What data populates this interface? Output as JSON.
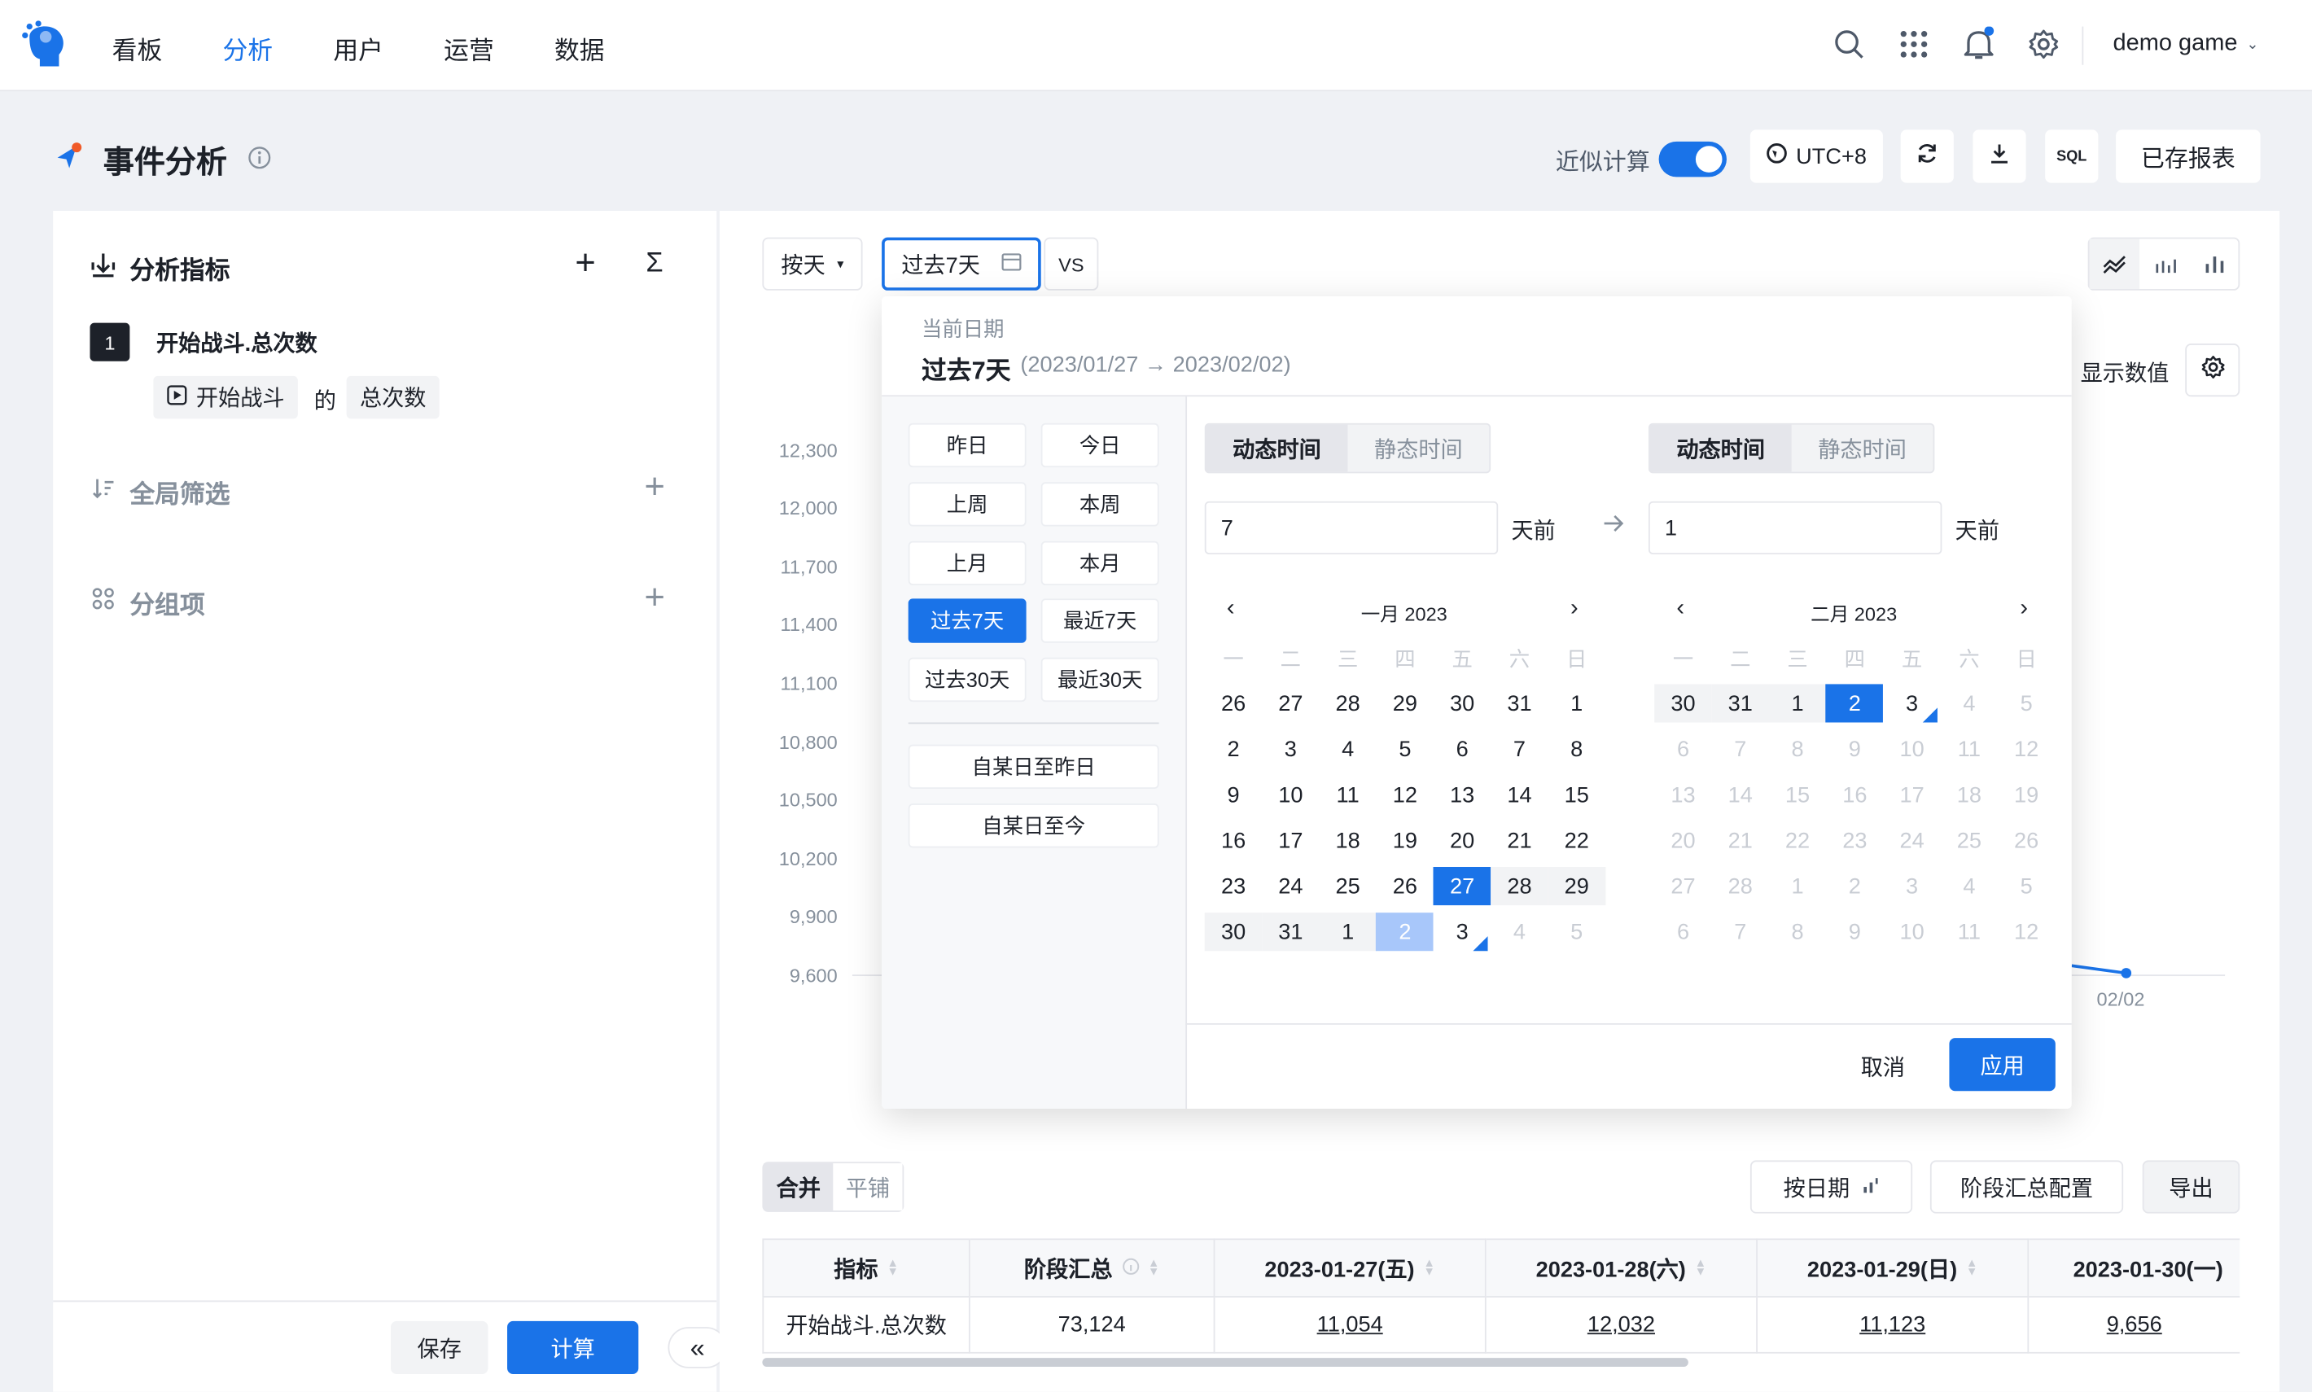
{
  "nav": {
    "items": [
      "看板",
      "分析",
      "用户",
      "运营",
      "数据"
    ],
    "active": "分析",
    "user": "demo game"
  },
  "page": {
    "title": "事件分析"
  },
  "toolbar": {
    "approx_label": "近似计算",
    "approx_on": true,
    "timezone": "UTC+8",
    "sql": "SQL",
    "saved": "已存报表"
  },
  "left": {
    "metrics_title": "分析指标",
    "metric_index": "1",
    "metric_name": "开始战斗.总次数",
    "event_tag": "开始战斗",
    "of": "的",
    "agg_tag": "总次数",
    "filter_title": "全局筛选",
    "group_title": "分组项",
    "save": "保存",
    "calc": "计算",
    "collapse": "«"
  },
  "controls": {
    "granularity": "按天",
    "range": "过去7天",
    "vs": "VS",
    "show_values": "显示数值"
  },
  "chart_data": {
    "type": "line",
    "y_ticks": [
      "12,300",
      "12,000",
      "11,700",
      "11,400",
      "11,100",
      "10,800",
      "10,500",
      "10,200",
      "9,900",
      "9,600"
    ],
    "x_visible": [
      "02/02"
    ]
  },
  "picker": {
    "current_label": "当前日期",
    "current_value": "过去7天",
    "current_range": "(2023/01/27 → 2023/02/02)",
    "quick": [
      [
        "昨日",
        "今日"
      ],
      [
        "上周",
        "本周"
      ],
      [
        "上月",
        "本月"
      ],
      [
        "过去7天",
        "最近7天"
      ],
      [
        "过去30天",
        "最近30天"
      ]
    ],
    "since_yesterday": "自某日至昨日",
    "since_today": "自某日至今",
    "tab_dynamic": "动态时间",
    "tab_static": "静态时间",
    "start_value": "7",
    "end_value": "1",
    "days_ago": "天前",
    "left_month": "一月 2023",
    "right_month": "二月 2023",
    "weekdays": [
      "一",
      "二",
      "三",
      "四",
      "五",
      "六",
      "日"
    ],
    "left_days": [
      [
        "26",
        "27",
        "28",
        "29",
        "30",
        "31",
        "1"
      ],
      [
        "2",
        "3",
        "4",
        "5",
        "6",
        "7",
        "8"
      ],
      [
        "9",
        "10",
        "11",
        "12",
        "13",
        "14",
        "15"
      ],
      [
        "16",
        "17",
        "18",
        "19",
        "20",
        "21",
        "22"
      ],
      [
        "23",
        "24",
        "25",
        "26",
        "27",
        "28",
        "29"
      ],
      [
        "30",
        "31",
        "1",
        "2",
        "3",
        "4",
        "5"
      ]
    ],
    "right_days": [
      [
        "30",
        "31",
        "1",
        "2",
        "3",
        "4",
        "5"
      ],
      [
        "6",
        "7",
        "8",
        "9",
        "10",
        "11",
        "12"
      ],
      [
        "13",
        "14",
        "15",
        "16",
        "17",
        "18",
        "19"
      ],
      [
        "20",
        "21",
        "22",
        "23",
        "24",
        "25",
        "26"
      ],
      [
        "27",
        "28",
        "1",
        "2",
        "3",
        "4",
        "5"
      ],
      [
        "6",
        "7",
        "8",
        "9",
        "10",
        "11",
        "12"
      ]
    ],
    "cancel": "取消",
    "apply": "应用"
  },
  "table": {
    "mode_merge": "合并",
    "mode_tile": "平铺",
    "by_date": "按日期",
    "stage_config": "阶段汇总配置",
    "export": "导出",
    "headers": [
      "指标",
      "阶段汇总",
      "2023-01-27(五)",
      "2023-01-28(六)",
      "2023-01-29(日)",
      "2023-01-30(一)"
    ],
    "row": [
      "开始战斗.总次数",
      "73,124",
      "11,054",
      "12,032",
      "11,123",
      "9,656"
    ]
  }
}
